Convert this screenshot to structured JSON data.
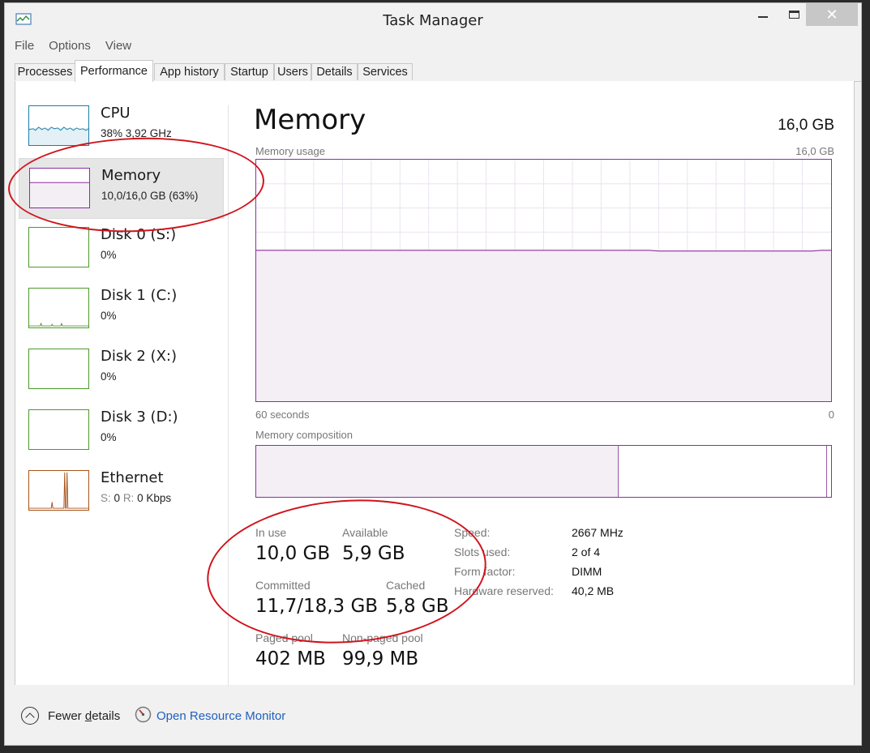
{
  "window": {
    "title": "Task Manager"
  },
  "menu": [
    "File",
    "Options",
    "View"
  ],
  "tabs": [
    "Processes",
    "Performance",
    "App history",
    "Startup",
    "Users",
    "Details",
    "Services"
  ],
  "active_tab": "Performance",
  "sidebar": [
    {
      "name": "CPU",
      "sub": "38%  3,92 GHz",
      "color": "#1a7fa8"
    },
    {
      "name": "Memory",
      "sub": "10,0/16,0 GB (63%)",
      "color": "#8b2fa0"
    },
    {
      "name": "Disk 0 (S:)",
      "sub": "0%",
      "color": "#4c9a2a"
    },
    {
      "name": "Disk 1 (C:)",
      "sub": "0%",
      "color": "#4c9a2a"
    },
    {
      "name": "Disk 2 (X:)",
      "sub": "0%",
      "color": "#4c9a2a"
    },
    {
      "name": "Disk 3 (D:)",
      "sub": "0%",
      "color": "#4c9a2a"
    },
    {
      "name": "Ethernet",
      "sub_s_label": "S:",
      "sub_s_value": "0",
      "sub_r_label": "R:",
      "sub_r_value": "0 Kbps",
      "color": "#a7531b"
    }
  ],
  "main": {
    "title": "Memory",
    "total": "16,0 GB",
    "usage_label": "Memory usage",
    "usage_max": "16,0 GB",
    "x_left": "60 seconds",
    "x_right": "0",
    "composition_label": "Memory composition",
    "composition_in_use_fraction": 0.63,
    "composition_modified_fraction": 0.008
  },
  "chart_data": {
    "type": "area",
    "title": "Memory usage",
    "xlabel": "",
    "ylabel": "",
    "x_range_seconds": [
      60,
      0
    ],
    "ylim": [
      0,
      16.0
    ],
    "unit": "GB",
    "y": [
      10.0,
      10.0,
      10.0,
      10.0,
      10.0,
      10.0,
      10.0,
      10.0,
      10.0,
      10.0,
      10.0,
      10.0,
      10.0,
      10.0,
      10.0,
      10.0,
      10.0,
      10.0,
      10.0,
      10.0,
      10.0,
      10.0,
      10.0,
      10.0,
      10.0,
      10.0,
      10.0,
      10.0,
      10.0,
      10.0,
      10.0,
      10.0,
      10.0,
      10.0,
      10.0,
      10.0,
      10.0,
      10.0,
      10.0,
      10.0,
      10.0,
      10.0,
      9.95,
      9.95,
      9.95,
      9.95,
      9.95,
      9.95,
      9.95,
      9.95,
      9.95,
      9.95,
      9.95,
      9.95,
      9.95,
      9.95,
      9.95,
      9.95,
      9.95,
      10.0,
      10.0
    ],
    "grid": true
  },
  "stats": {
    "in_use_label": "In use",
    "in_use": "10,0 GB",
    "available_label": "Available",
    "available": "5,9 GB",
    "committed_label": "Committed",
    "committed": "11,7/18,3 GB",
    "cached_label": "Cached",
    "cached": "5,8 GB",
    "paged_label": "Paged pool",
    "paged": "402 MB",
    "nonpaged_label": "Non-paged pool",
    "nonpaged": "99,9 MB"
  },
  "details": [
    {
      "label": "Speed:",
      "value": "2667 MHz"
    },
    {
      "label": "Slots used:",
      "value": "2 of 4"
    },
    {
      "label": "Form factor:",
      "value": "DIMM"
    },
    {
      "label": "Hardware reserved:",
      "value": "40,2 MB"
    }
  ],
  "footer": {
    "fewer_prefix": "Fewer ",
    "fewer_underlined": "d",
    "fewer_suffix": "etails",
    "resource_monitor": "Open Resource Monitor"
  },
  "colors": {
    "memory": "#8b2fa0",
    "annotation": "#d0141c",
    "link": "#1f5fbf"
  }
}
